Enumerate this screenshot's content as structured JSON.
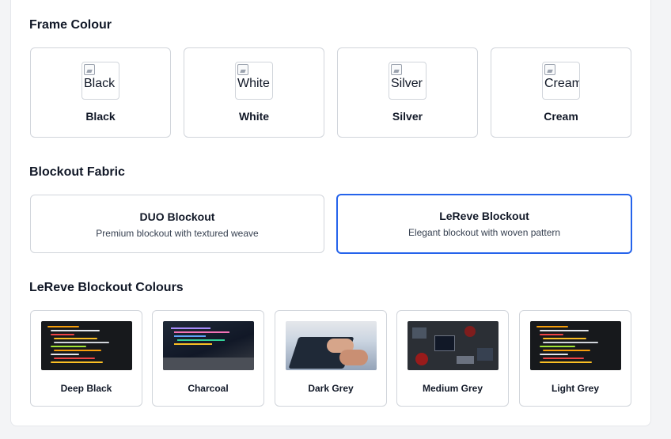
{
  "frame_colour": {
    "title": "Frame Colour",
    "options": [
      {
        "label": "Black",
        "alt": "Black"
      },
      {
        "label": "White",
        "alt": "White"
      },
      {
        "label": "Silver",
        "alt": "Silver"
      },
      {
        "label": "Cream",
        "alt": "Cream"
      }
    ]
  },
  "blockout_fabric": {
    "title": "Blockout Fabric",
    "selected_index": 1,
    "accent_color": "#2563eb",
    "options": [
      {
        "name": "DUO Blockout",
        "description": "Premium blockout with textured weave"
      },
      {
        "name": "LeReve Blockout",
        "description": "Elegant blockout with woven pattern"
      }
    ]
  },
  "blockout_colours": {
    "title": "LeReve Blockout Colours",
    "options": [
      {
        "label": "Deep Black",
        "image": "code-screen-image"
      },
      {
        "label": "Charcoal",
        "image": "laptop-code-image"
      },
      {
        "label": "Dark Grey",
        "image": "typing-hands-image"
      },
      {
        "label": "Medium Grey",
        "image": "circuit-board-image"
      },
      {
        "label": "Light Grey",
        "image": "code-screen-image"
      }
    ]
  }
}
